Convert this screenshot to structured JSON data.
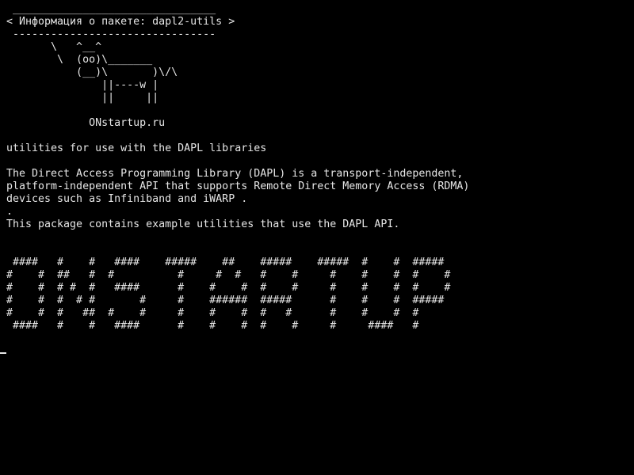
{
  "cowsay": {
    "border_top": " ________________________________",
    "message": "< Информация о пакете: dapl2-utils >",
    "border_bottom": " --------------------------------",
    "cow": [
      "       \\   ^__^",
      "        \\  (oo)\\_______",
      "           (__)\\       )\\/\\",
      "               ||----w |",
      "               ||     ||"
    ],
    "site": "             ONstartup.ru"
  },
  "description": {
    "summary": "utilities for use with the DAPL libraries",
    "paragraph": [
      "The Direct Access Programming Library (DAPL) is a transport-independent,",
      "platform-independent API that supports Remote Direct Memory Access (RDMA)",
      "devices such as Infiniband and iWARP ."
    ],
    "separator": ".",
    "note": "This package contains example utilities that use the DAPL API."
  },
  "banner": [
    " ####   #    #   ####    #####    ##    #####    #####  #    #  #####",
    "#    #  ##   #  #          #     #  #   #    #     #    #    #  #    #",
    "#    #  # #  #   ####      #    #    #  #    #     #    #    #  #    #",
    "#    #  #  # #       #     #    ######  #####      #    #    #  #####",
    "#    #  #   ##  #    #     #    #    #  #   #      #    #    #  #",
    " ####   #    #   ####      #    #    #  #    #     #     ####   #"
  ]
}
